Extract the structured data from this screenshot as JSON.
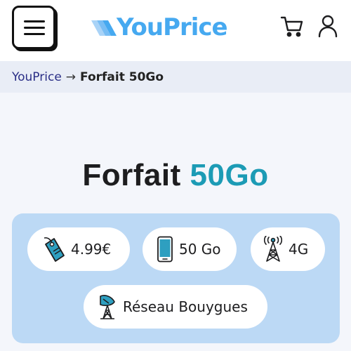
{
  "header": {
    "menu_icon": "hamburger-menu-icon",
    "logo_text": "YouPrice",
    "cart_icon": "shopping-cart-icon",
    "user_icon": "user-account-icon",
    "colors": {
      "logo": "#46a9f0",
      "accent": "#1c9bb5"
    }
  },
  "breadcrumb": {
    "home": "YouPrice",
    "separator": "→",
    "current": "Forfait 50Go"
  },
  "page": {
    "title_main": "Forfait",
    "title_accent": "50Go"
  },
  "features": [
    {
      "icon": "price-tag-icon",
      "label": "4.99€"
    },
    {
      "icon": "smartphone-icon",
      "label": "50 Go"
    },
    {
      "icon": "antenna-tower-icon",
      "label": "4G"
    },
    {
      "icon": "satellite-dish-icon",
      "label": "Réseau Bouygues"
    }
  ]
}
